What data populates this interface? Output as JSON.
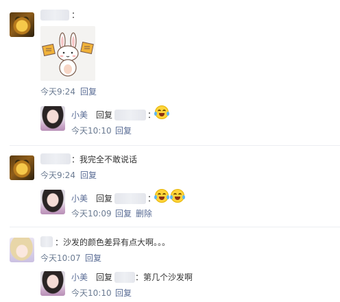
{
  "colors": {
    "link": "#586b94",
    "time": "#6b7b92",
    "text": "#333333"
  },
  "comments": [
    {
      "text": "：",
      "time": "今天9:24",
      "reply_label": "回复",
      "sticker": "rabbit-holding-signs-sticker",
      "reply": {
        "user": "小美",
        "reply_word": "回复",
        "colon": "：",
        "emojis": [
          "laugh-cry-emoji"
        ],
        "time": "今天10:10",
        "reply_label": "回复"
      }
    },
    {
      "text": "：我完全不敢说话",
      "time": "今天9:24",
      "reply_label": "回复",
      "reply": {
        "user": "小美",
        "reply_word": "回复",
        "colon": "：",
        "emojis": [
          "laugh-cry-emoji",
          "laugh-cry-emoji"
        ],
        "time": "今天10:09",
        "reply_label": "回复",
        "delete_label": "删除"
      }
    },
    {
      "text": "：沙发的颜色差异有点大啊。。。",
      "time": "今天10:07",
      "reply_label": "回复",
      "reply": {
        "user": "小美",
        "reply_word": "回复",
        "text": "：第几个沙发啊",
        "time": "今天10:10",
        "reply_label": "回复"
      }
    }
  ]
}
